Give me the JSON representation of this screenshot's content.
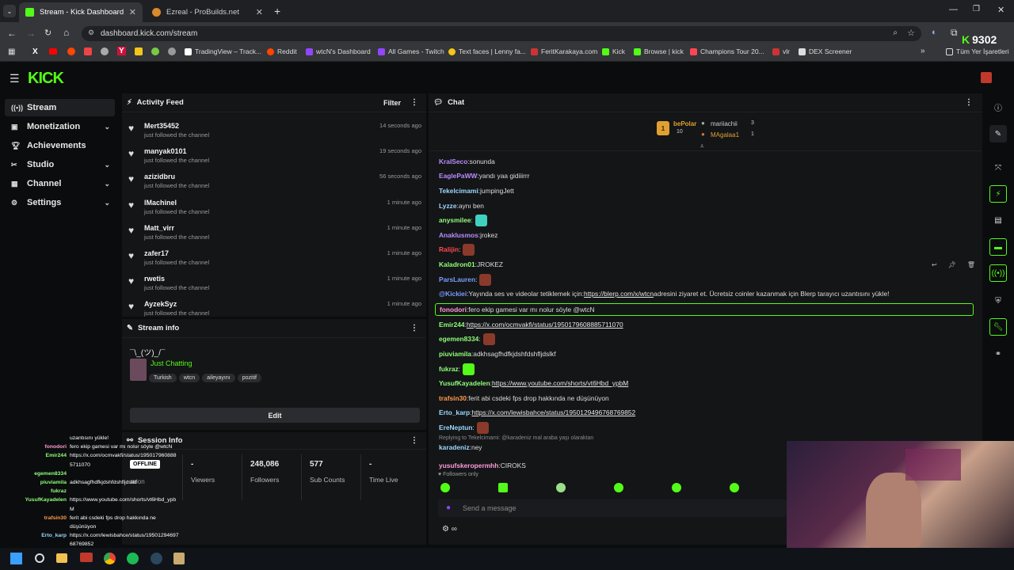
{
  "browser": {
    "tabs": [
      {
        "title": "Stream - Kick Dashboard",
        "active": true
      },
      {
        "title": "Ezreal - ProBuilds.net",
        "active": false
      }
    ],
    "url": "dashboard.kick.com/stream",
    "bookmarks": [
      "TradingView – Track...",
      "Reddit",
      "wtcN's Dashboard",
      "All Games - Twitch",
      "Text faces | Lenny fa...",
      "FeritKarakaya.com",
      "Kick",
      "Browse | kick",
      "Champions Tour 20...",
      "vlr",
      "DEX Screener"
    ],
    "bookmarks_all": "Tüm Yer İşaretleri",
    "overlay_count": "9302"
  },
  "app": {
    "logo": "KICK",
    "brand_color": "#53fc18"
  },
  "sidebar": {
    "items": [
      {
        "label": "Stream",
        "icon": "broadcast-icon"
      },
      {
        "label": "Monetization",
        "icon": "money-icon"
      },
      {
        "label": "Achievements",
        "icon": "trophy-icon"
      },
      {
        "label": "Studio",
        "icon": "tools-icon"
      },
      {
        "label": "Channel",
        "icon": "grid-icon"
      },
      {
        "label": "Settings",
        "icon": "gear-icon"
      }
    ]
  },
  "activity_feed": {
    "title": "Activity Feed",
    "filter_label": "Filter",
    "items": [
      {
        "name": "Mert35452",
        "action": "just followed the channel",
        "time": "14 seconds ago"
      },
      {
        "name": "manyak0101",
        "action": "just followed the channel",
        "time": "19 seconds ago"
      },
      {
        "name": "azizidbru",
        "action": "just followed the channel",
        "time": "56 seconds ago"
      },
      {
        "name": "lMachinel",
        "action": "just followed the channel",
        "time": "1 minute ago"
      },
      {
        "name": "Matt_virr",
        "action": "just followed the channel",
        "time": "1 minute ago"
      },
      {
        "name": "zafer17",
        "action": "just followed the channel",
        "time": "1 minute ago"
      },
      {
        "name": "rwetis",
        "action": "just followed the channel",
        "time": "1 minute ago"
      },
      {
        "name": "AyzekSyz",
        "action": "just followed the channel",
        "time": "1 minute ago"
      }
    ]
  },
  "stream_info": {
    "title": "Stream info",
    "stream_title": "¯\\_(ツ)_/¯",
    "category": "Just Chatting",
    "tags": [
      "Turkish",
      "wtcn",
      "aileyayını",
      "pozitif"
    ],
    "edit_label": "Edit"
  },
  "session_info": {
    "title": "Session Info",
    "status": "OFFLINE",
    "stats": [
      {
        "value": "-",
        "label": "Viewers"
      },
      {
        "value": "248,086",
        "label": "Followers"
      },
      {
        "value": "577",
        "label": "Sub Counts"
      },
      {
        "value": "-",
        "label": "Time Live"
      }
    ],
    "session_label": "ssion"
  },
  "chat": {
    "title": "Chat",
    "leaderboard": {
      "first": {
        "name": "bePolar",
        "count": "10",
        "rank": "1"
      },
      "second": {
        "name": "mariiachii",
        "count": "3"
      },
      "third": {
        "name": "MAgalaa1",
        "count": "1"
      }
    },
    "messages": [
      {
        "user": "KralSeco",
        "color": "#b98cff",
        "text": "sonunda"
      },
      {
        "user": "EaglePaWW",
        "color": "#b98cff",
        "text": "yandı yaa gidiiirrr"
      },
      {
        "user": "Tekelcimami",
        "color": "#9bd8ff",
        "text": "jumpingJett"
      },
      {
        "user": "Lyzze",
        "color": "#9bd8ff",
        "text": "aynı ben"
      },
      {
        "user": "anysmilee",
        "color": "#8fff7a",
        "text": ""
      },
      {
        "user": "Anaklusmos",
        "color": "#b98cff",
        "text": "jrokez"
      },
      {
        "user": "Ralijin",
        "color": "#ff4b4b",
        "text": ""
      },
      {
        "user": "Kaladron01",
        "color": "#8fff7a",
        "text": "JROKEZ"
      },
      {
        "user": "ParsLauren",
        "color": "#7a9dff",
        "text": ""
      },
      {
        "user": "@Kickiei",
        "color": "#7a9dff",
        "text": "Yayında ses ve videolar tetiklemek için: ",
        "link": "https://blerp.com/x/wtcn",
        "text2": " adresini ziyaret et. Ücretsiz coinler kazanmak için Blerp tarayıcı uzantısını yükle!"
      },
      {
        "user": "fonodori",
        "color": "#ff9bd8",
        "text": "fero ekip gamesi var mı nolur söyle @wtcN"
      },
      {
        "user": "Emir244",
        "color": "#8fff7a",
        "text": "",
        "link": "https://x.com/ocmvakfi/status/1950179608885711070"
      },
      {
        "user": "egemen8334",
        "color": "#8fff7a",
        "text": ""
      },
      {
        "user": "piuviamila",
        "color": "#8fff7a",
        "text": "adkhsagfhdfkjdshfdshfljdslkf"
      },
      {
        "user": "fukraz",
        "color": "#8fff7a",
        "text": ""
      },
      {
        "user": "YusufKayadelen",
        "color": "#8fff7a",
        "text": "",
        "link": "https://www.youtube.com/shorts/vt6Hbd_ypbM"
      },
      {
        "user": "trafsin30",
        "color": "#ff9b4b",
        "text": "ferit abi csdeki fps drop hakkında ne düşünüyon"
      },
      {
        "user": "Erto_karp",
        "color": "#9bd8ff",
        "text": "",
        "link": "https://x.com/lewisbahce/status/1950129496768769852"
      },
      {
        "user": "EreNeptun",
        "color": "#9bd8ff",
        "text": ""
      },
      {
        "user": "karadeniz",
        "color": "#9bd8ff",
        "text": "ney",
        "reply": "Replying to Tekelcimami: @karadeniz mal araba yaşı olaraktan"
      },
      {
        "user": "yusufskeropermhh",
        "color": "#ff9bd8",
        "text": "CIROKS"
      }
    ],
    "followers_only": "Followers only",
    "input_placeholder": "Send a message"
  },
  "overlay_chat": [
    {
      "user": "",
      "text": "uzantısını yükle!",
      "color": "#ffffff"
    },
    {
      "user": "fonodori",
      "text": "fero ekip gamesi var mı nolur söyle @wtcN",
      "color": "#ff9bd8"
    },
    {
      "user": "Emir244",
      "text": "https://x.com/ocmvakfi/status/195017960888",
      "color": "#8fff7a"
    },
    {
      "user": "",
      "text": "5711070",
      "color": "#ffffff"
    },
    {
      "user": "egemen8334",
      "text": "",
      "color": "#8fff7a"
    },
    {
      "user": "piuviamila",
      "text": "adkhsagfhdfkjdshfdshfljdslkf",
      "color": "#8fff7a"
    },
    {
      "user": "fukraz",
      "text": "",
      "color": "#8fff7a"
    },
    {
      "user": "YusufKayadelen",
      "text": "https://www.youtube.com/shorts/vt6Hbd_ypb",
      "color": "#8fff7a"
    },
    {
      "user": "",
      "text": "M",
      "color": "#ffffff"
    },
    {
      "user": "trafsin30",
      "text": "ferit abi csdeki fps drop hakkında ne",
      "color": "#ff9b4b"
    },
    {
      "user": "",
      "text": "düşünüyon",
      "color": "#ffffff"
    },
    {
      "user": "Erto_karp",
      "text": "https://x.com/lewisbahce/status/19501294697",
      "color": "#9bd8ff"
    },
    {
      "user": "",
      "text": "68769852",
      "color": "#ffffff"
    },
    {
      "user": "yusufskeropermhh",
      "text": "CIROKS",
      "color": "#ff9bd8"
    }
  ]
}
